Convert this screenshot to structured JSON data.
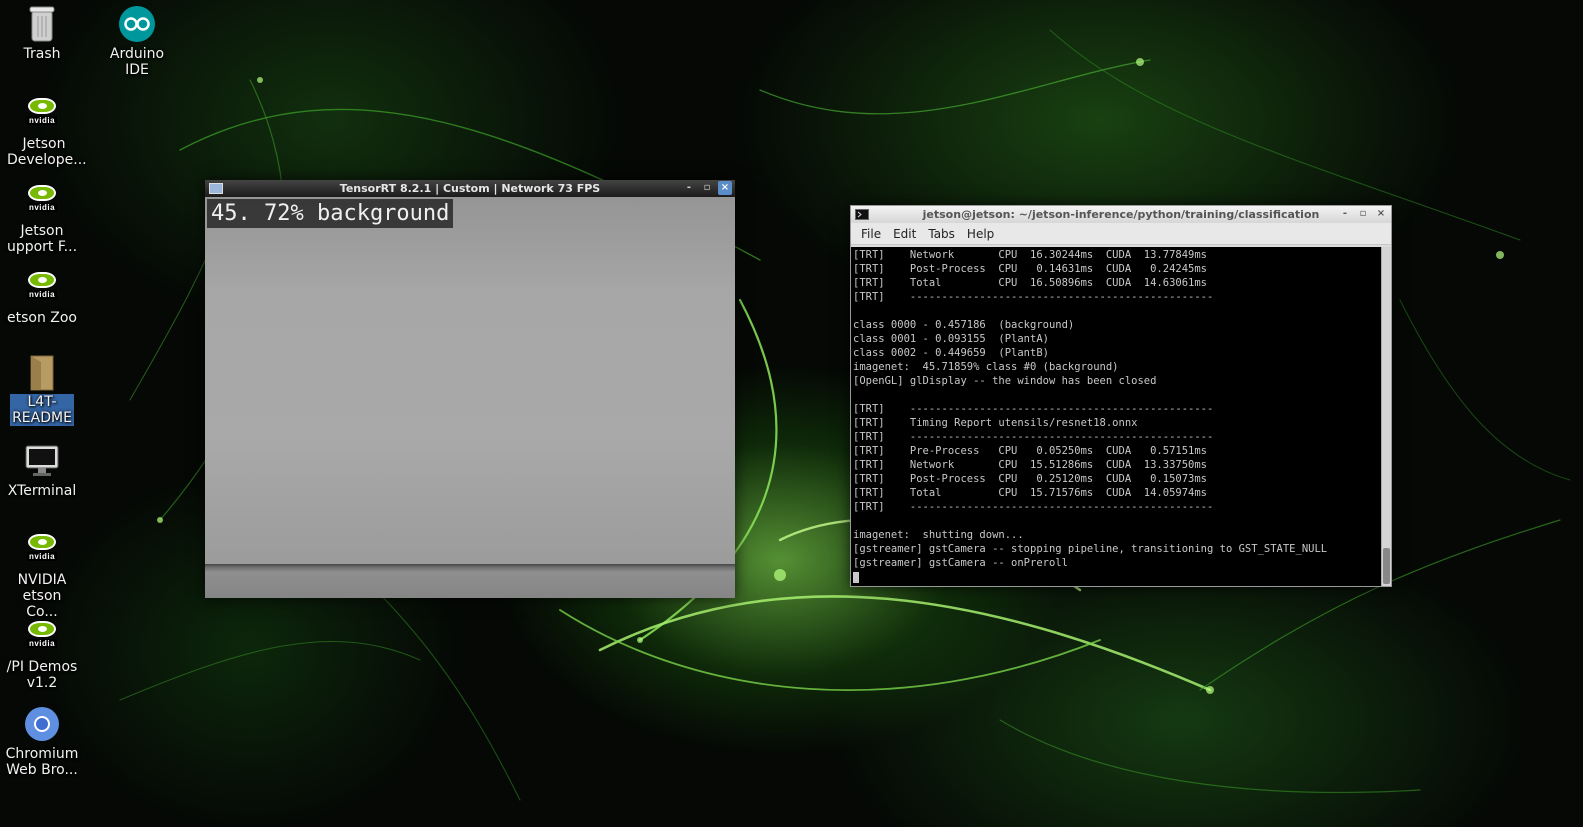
{
  "desktop": {
    "icons": [
      {
        "label": "Trash",
        "icon": "trash-icon"
      },
      {
        "label": "Arduino IDE",
        "icon": "arduino-icon"
      },
      {
        "label": "Jetson Develope...",
        "icon": "nvidia-icon"
      },
      {
        "label": "Jetson upport F...",
        "icon": "nvidia-icon"
      },
      {
        "label": "etson Zoo",
        "icon": "nvidia-icon"
      },
      {
        "label": "L4T-README",
        "icon": "folder-icon"
      },
      {
        "label": "XTerminal",
        "icon": "monitor-icon"
      },
      {
        "label": "NVIDIA etson Co...",
        "icon": "nvidia-icon"
      },
      {
        "label": "/PI Demos v1.2",
        "icon": "nvidia-icon"
      },
      {
        "label": "Chromium Web Bro...",
        "icon": "chromium-icon"
      }
    ],
    "nvidia_logo_text": "nvidia"
  },
  "camera_window": {
    "title": "TensorRT 8.2.1 | Custom | Network 73 FPS",
    "overlay_text": "45. 72% background",
    "controls": {
      "minimize": "-",
      "maximize": "▫",
      "close": "×"
    }
  },
  "terminal_window": {
    "title": "jetson@jetson: ~/jetson-inference/python/training/classification",
    "menu": [
      "File",
      "Edit",
      "Tabs",
      "Help"
    ],
    "controls": {
      "minimize": "-",
      "maximize": "▫",
      "close": "×"
    },
    "lines": [
      "[TRT]    Network       CPU  16.30244ms  CUDA  13.77849ms",
      "[TRT]    Post-Process  CPU   0.14631ms  CUDA   0.24245ms",
      "[TRT]    Total         CPU  16.50896ms  CUDA  14.63061ms",
      "[TRT]    ------------------------------------------------",
      "",
      "class 0000 - 0.457186  (background)",
      "class 0001 - 0.093155  (PlantA)",
      "class 0002 - 0.449659  (PlantB)",
      "imagenet:  45.71859% class #0 (background)",
      "[OpenGL] glDisplay -- the window has been closed",
      "",
      "[TRT]    ------------------------------------------------",
      "[TRT]    Timing Report utensils/resnet18.onnx",
      "[TRT]    ------------------------------------------------",
      "[TRT]    Pre-Process   CPU   0.05250ms  CUDA   0.57151ms",
      "[TRT]    Network       CPU  15.51286ms  CUDA  13.33750ms",
      "[TRT]    Post-Process  CPU   0.25120ms  CUDA   0.15073ms",
      "[TRT]    Total         CPU  15.71576ms  CUDA  14.05974ms",
      "[TRT]    ------------------------------------------------",
      "",
      "imagenet:  shutting down...",
      "[gstreamer] gstCamera -- stopping pipeline, transitioning to GST_STATE_NULL",
      "[gstreamer] gstCamera -- onPreroll"
    ]
  }
}
